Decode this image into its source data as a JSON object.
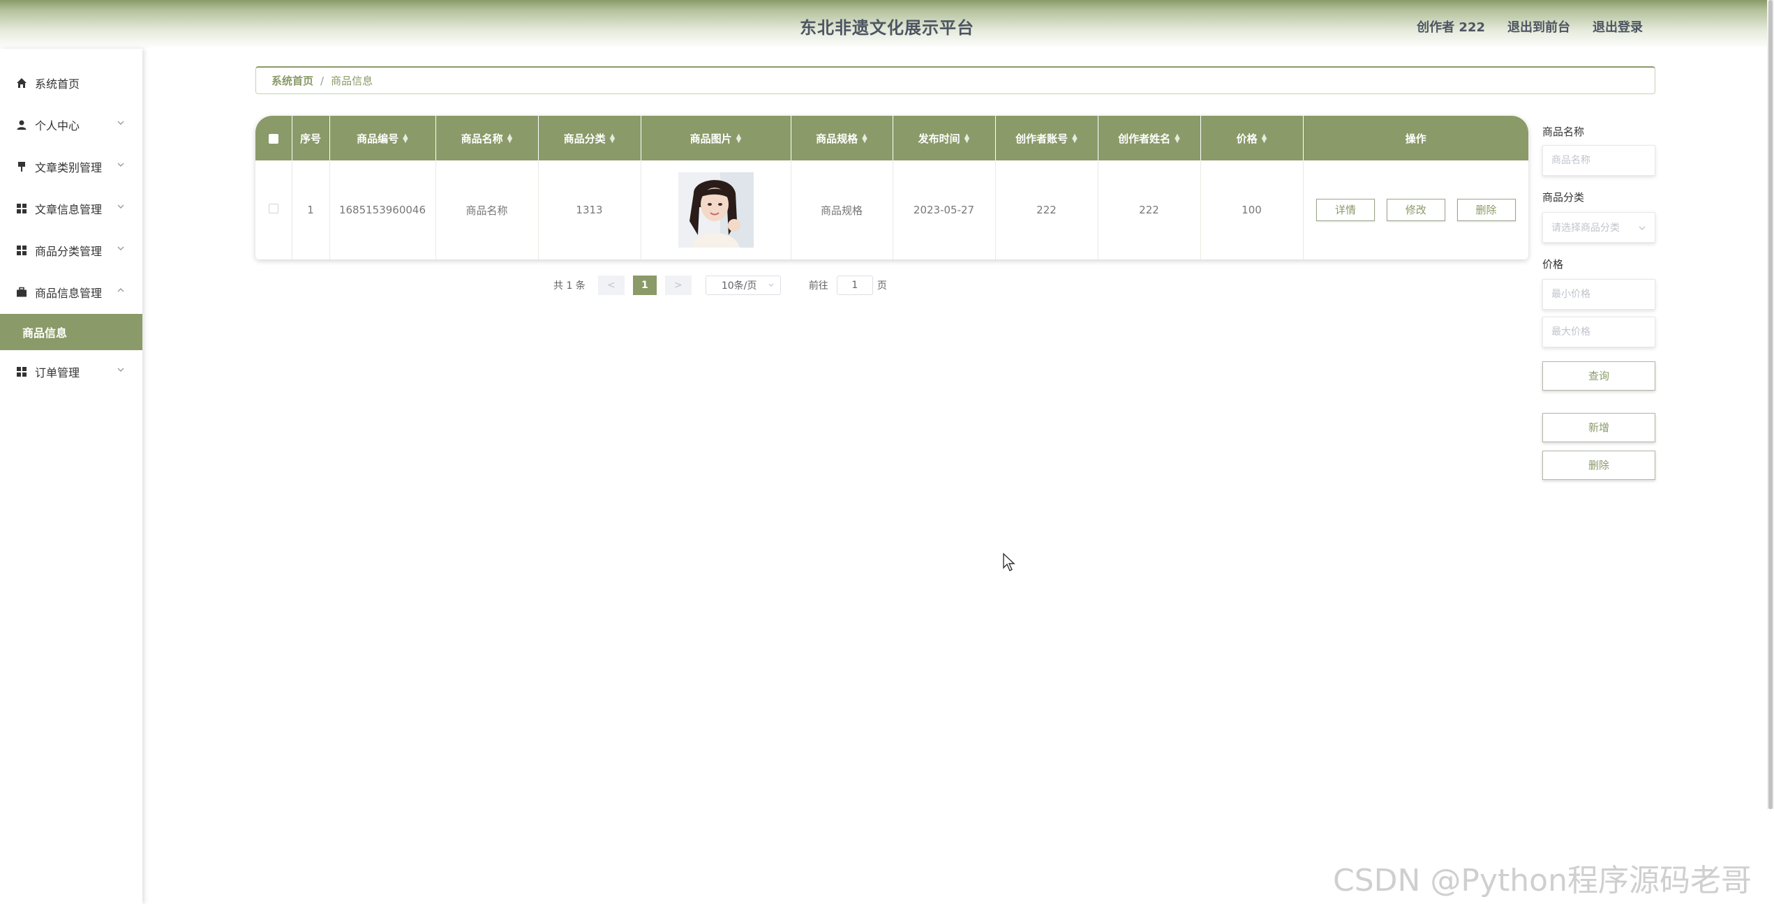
{
  "header": {
    "title": "东北非遗文化展示平台",
    "user_label": "创作者 222",
    "back_front": "退出到前台",
    "logout": "退出登录"
  },
  "sidebar": {
    "items": [
      {
        "label": "系统首页",
        "icon": "home-icon"
      },
      {
        "label": "个人中心",
        "icon": "user-icon"
      },
      {
        "label": "文章类别管理",
        "icon": "pin-icon"
      },
      {
        "label": "文章信息管理",
        "icon": "grid-icon"
      },
      {
        "label": "商品分类管理",
        "icon": "grid-icon"
      },
      {
        "label": "商品信息管理",
        "icon": "briefcase-icon"
      },
      {
        "label": "订单管理",
        "icon": "grid-icon"
      }
    ],
    "active_sub": "商品信息"
  },
  "breadcrumb": {
    "home": "系统首页",
    "separator": "/",
    "current": "商品信息"
  },
  "table": {
    "columns": [
      "序号",
      "商品编号",
      "商品名称",
      "商品分类",
      "商品图片",
      "商品规格",
      "发布时间",
      "创作者账号",
      "创作者姓名",
      "价格",
      "操作"
    ],
    "rows": [
      {
        "index": "1",
        "code": "1685153960046",
        "name": "商品名称",
        "category": "1313",
        "spec": "商品规格",
        "date": "2023-05-27",
        "account": "222",
        "creator": "222",
        "price": "100"
      }
    ],
    "actions": {
      "detail": "详情",
      "edit": "修改",
      "delete": "删除"
    }
  },
  "pagination": {
    "total": "共 1 条",
    "prev": "<",
    "page": "1",
    "next": ">",
    "page_size": "10条/页",
    "goto_prefix": "前往",
    "goto_value": "1",
    "goto_suffix": "页"
  },
  "search": {
    "name_label": "商品名称",
    "name_placeholder": "商品名称",
    "category_label": "商品分类",
    "category_placeholder": "请选择商品分类",
    "price_label": "价格",
    "min_price_placeholder": "最小价格",
    "max_price_placeholder": "最大价格",
    "query_button": "查询",
    "add_button": "新增",
    "delete_button": "删除"
  },
  "watermark": "CSDN @Python程序源码老哥",
  "colors": {
    "accent": "#8a9a68",
    "text_dark": "#4d5563"
  }
}
